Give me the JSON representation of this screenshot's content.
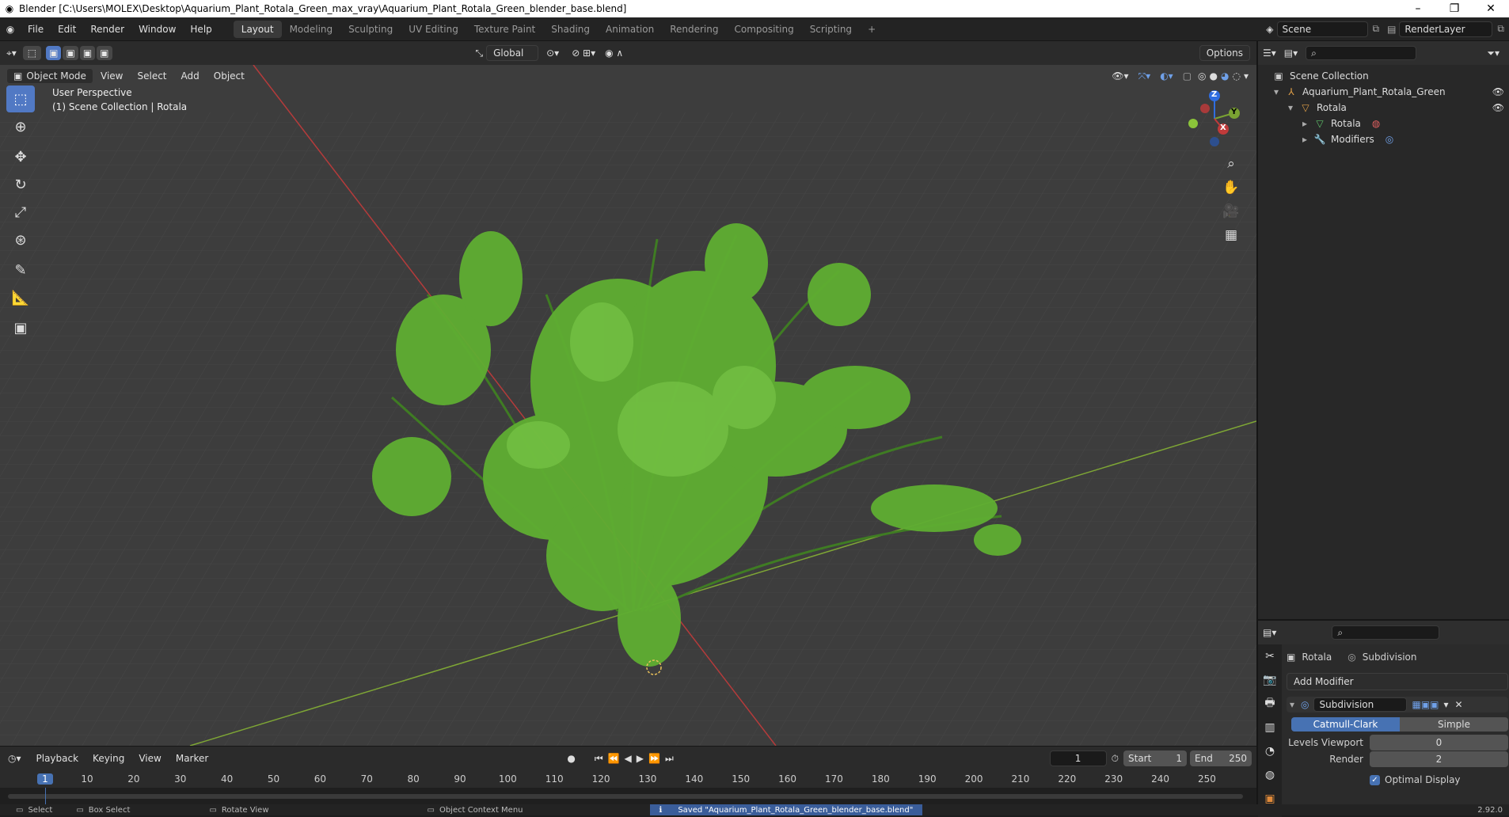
{
  "window": {
    "title": "Blender [C:\\Users\\MOLEX\\Desktop\\Aquarium_Plant_Rotala_Green_max_vray\\Aquarium_Plant_Rotala_Green_blender_base.blend]",
    "minimize": "–",
    "restore": "❐",
    "close": "✕"
  },
  "menus": [
    "File",
    "Edit",
    "Render",
    "Window",
    "Help"
  ],
  "workspaces": [
    "Layout",
    "Modeling",
    "Sculpting",
    "UV Editing",
    "Texture Paint",
    "Shading",
    "Animation",
    "Rendering",
    "Compositing",
    "Scripting"
  ],
  "workspace_add": "+",
  "scene": {
    "name": "Scene",
    "renderlayer": "RenderLayer"
  },
  "viewport_header": {
    "orientation": "Global",
    "options": "Options",
    "mode": "Object Mode",
    "menus": [
      "View",
      "Select",
      "Add",
      "Object"
    ]
  },
  "viewport": {
    "view_name": "User Perspective",
    "collection_info": "(1) Scene Collection | Rotala",
    "gizmo_labels": {
      "z": "Z",
      "y": "Y",
      "x": "X"
    }
  },
  "outliner": {
    "rows": [
      {
        "label": "Scene Collection"
      },
      {
        "label": "Aquarium_Plant_Rotala_Green"
      },
      {
        "label": "Rotala"
      },
      {
        "label": "Rotala"
      },
      {
        "label": "Modifiers"
      }
    ]
  },
  "properties": {
    "object_name": "Rotala",
    "modifier_context": "Subdivision",
    "add_modifier": "Add Modifier",
    "modifier_name": "Subdivision",
    "tabs": {
      "catmull": "Catmull-Clark",
      "simple": "Simple"
    },
    "levels_viewport_label": "Levels Viewport",
    "levels_viewport_value": "0",
    "render_label": "Render",
    "render_value": "2",
    "optimal_display": "Optimal Display"
  },
  "timeline": {
    "menus": [
      "Playback",
      "Keying",
      "View",
      "Marker"
    ],
    "current_frame": "1",
    "start_label": "Start",
    "start_value": "1",
    "end_label": "End",
    "end_value": "250",
    "ticks": [
      "1",
      "10",
      "20",
      "30",
      "40",
      "50",
      "60",
      "70",
      "80",
      "90",
      "100",
      "110",
      "120",
      "130",
      "140",
      "150",
      "160",
      "170",
      "180",
      "190",
      "200",
      "210",
      "220",
      "230",
      "240",
      "250"
    ]
  },
  "statusbar": {
    "select": "Select",
    "box_select": "Box Select",
    "rotate": "Rotate View",
    "context": "Object Context Menu",
    "message": "Saved \"Aquarium_Plant_Rotala_Green_blender_base.blend\"",
    "version": "2.92.0"
  },
  "colors": {
    "accent": "#4772b3",
    "leaf": "#5fae32",
    "xaxis": "#c03a3a",
    "yaxis": "#7aa232"
  }
}
